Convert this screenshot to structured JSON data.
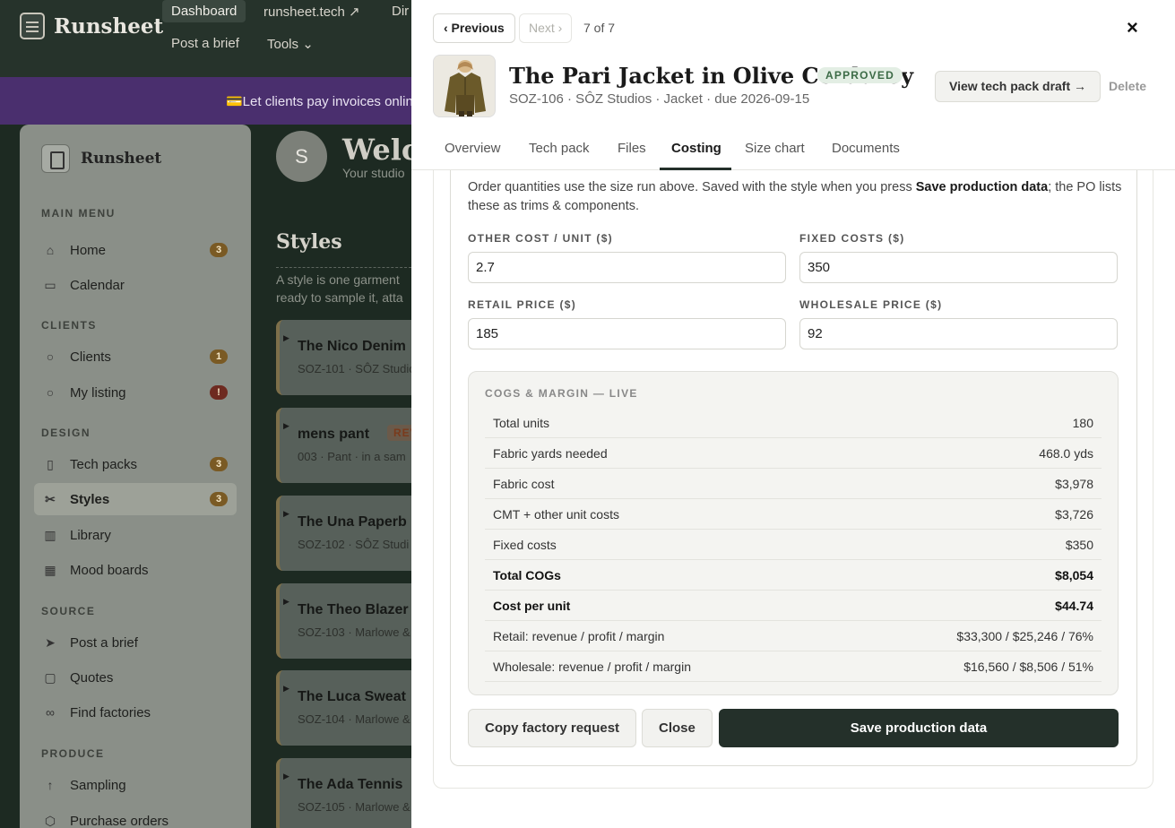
{
  "app": {
    "brand": "Runsheet",
    "nav": [
      "Dashboard",
      "runsheet.tech ↗",
      "Dir",
      "Post a brief",
      "Tools"
    ],
    "banner": "💳Let clients pay invoices onlin"
  },
  "sidebar": {
    "brand": "Runsheet",
    "sections": {
      "main": "MAIN MENU",
      "clients": "CLIENTS",
      "design": "DESIGN",
      "source": "SOURCE",
      "produce": "PRODUCE"
    },
    "items": [
      {
        "label": "Home",
        "badge": "3"
      },
      {
        "label": "Calendar",
        "badge": ""
      },
      {
        "label": "Clients",
        "badge": "1"
      },
      {
        "label": "My listing",
        "badge": "!"
      },
      {
        "label": "Tech packs",
        "badge": "3"
      },
      {
        "label": "Styles",
        "badge": "3"
      },
      {
        "label": "Library",
        "badge": ""
      },
      {
        "label": "Mood boards",
        "badge": ""
      },
      {
        "label": "Post a brief",
        "badge": ""
      },
      {
        "label": "Quotes",
        "badge": ""
      },
      {
        "label": "Find factories",
        "badge": ""
      },
      {
        "label": "Sampling",
        "badge": ""
      },
      {
        "label": "Purchase orders",
        "badge": ""
      }
    ]
  },
  "main": {
    "avatar_initial": "S",
    "welcome": "Welco",
    "welcome_sub": "Your studio",
    "styles_heading": "Styles",
    "styles_desc_1": "A style is one garment",
    "styles_desc_2": "ready to sample it, atta",
    "cards": [
      {
        "title": "The Nico Denim",
        "sub": "SOZ-101 · SÔZ Studio",
        "badge": ""
      },
      {
        "title": "mens pant",
        "sub": "003 · Pant · in a sam",
        "badge": "REV"
      },
      {
        "title": "The Una Paperb",
        "sub": "SOZ-102 · SÔZ Studi",
        "badge": ""
      },
      {
        "title": "The Theo Blazer",
        "sub": "SOZ-103 · Marlowe &",
        "badge": ""
      },
      {
        "title": "The Luca Sweat",
        "sub": "SOZ-104 · Marlowe &",
        "badge": ""
      },
      {
        "title": "The Ada Tennis",
        "sub": "SOZ-105 · Marlowe &",
        "badge": ""
      }
    ]
  },
  "modal": {
    "prev_label": "‹ Previous",
    "next_label": "Next ›",
    "counter": "7 of 7",
    "close_icon": "×",
    "title": "The Pari Jacket in Olive Corduroy",
    "status": "APPROVED",
    "subtitle": "SOZ-106 · SÔZ Studios · Jacket · due 2026-09-15",
    "view_techpack": "View tech pack draft →",
    "delete": "Delete",
    "tabs": [
      "Overview",
      "Tech pack",
      "Files",
      "Costing",
      "Size chart",
      "Documents"
    ],
    "active_tab": "Costing",
    "intro_pre": "Order quantities use the size run above. Saved with the style when you press ",
    "intro_bold": "Save production data",
    "intro_post": "; the PO lists these as trims & components.",
    "fields": {
      "other_cost_label": "OTHER COST / UNIT ($)",
      "other_cost_value": "2.7",
      "fixed_costs_label": "FIXED COSTS ($)",
      "fixed_costs_value": "350",
      "retail_label": "RETAIL PRICE ($)",
      "retail_value": "185",
      "wholesale_label": "WHOLESALE PRICE ($)",
      "wholesale_value": "92"
    },
    "cogs_heading": "COGS & MARGIN — LIVE",
    "cogs_rows": [
      {
        "label": "Total units",
        "value": "180"
      },
      {
        "label": "Fabric yards needed",
        "value": "468.0 yds"
      },
      {
        "label": "Fabric cost",
        "value": "$3,978"
      },
      {
        "label": "CMT + other unit costs",
        "value": "$3,726"
      },
      {
        "label": "Fixed costs",
        "value": "$350"
      },
      {
        "label": "Total COGs",
        "value": "$8,054"
      },
      {
        "label": "Cost per unit",
        "value": "$44.74"
      },
      {
        "label": "Retail: revenue / profit / margin",
        "value": "$33,300 / $25,246 / 76%"
      },
      {
        "label": "Wholesale: revenue / profit / margin",
        "value": "$16,560 / $8,506 / 51%"
      }
    ],
    "copy_request": "Copy factory request",
    "close_label": "Close",
    "save_label": "Save production data"
  },
  "colors": {
    "accent_dark": "#24302a",
    "approved_bg": "#e3eee4",
    "approved_text": "#3c6b46",
    "banner": "#4a2f6e"
  }
}
